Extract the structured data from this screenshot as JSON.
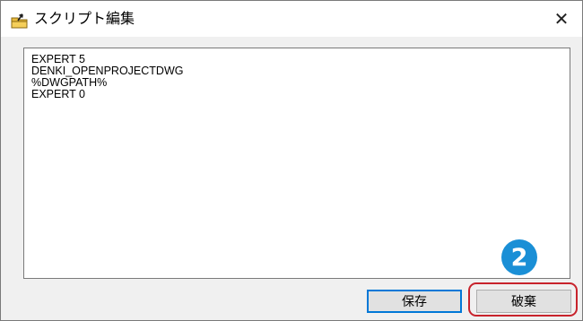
{
  "window": {
    "title": "スクリプト編集",
    "close_glyph": "✕",
    "icon": "folder-with-arrow-icon"
  },
  "editor": {
    "lines": [
      "EXPERT 5",
      "DENKI_OPENPROJECTDWG",
      "%DWGPATH%",
      "EXPERT 0"
    ]
  },
  "buttons": {
    "save_label": "保存",
    "discard_label": "破棄"
  },
  "annotation": {
    "step_number": "2",
    "badge_color": "#1a8fd6",
    "highlight_color": "#c8232c"
  }
}
